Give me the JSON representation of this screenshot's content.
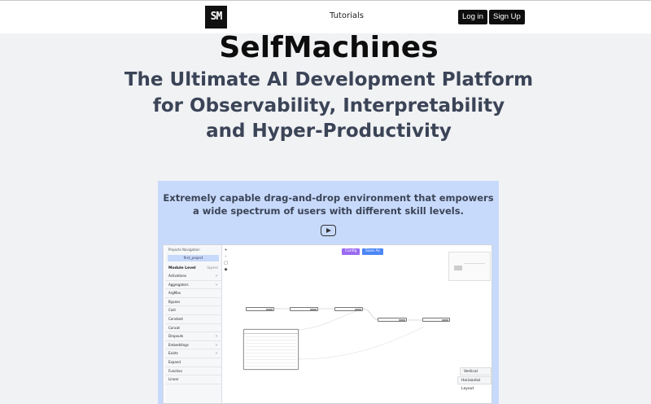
{
  "header": {
    "logo_text": "SM",
    "nav_tutorials": "Tutorials",
    "login_label": "Log in",
    "signup_label": "Sign Up"
  },
  "hero": {
    "title": "SelfMachines",
    "subtitle_line1": "The Ultimate AI Development Platform",
    "subtitle_line2": "for Observability, Interpretability",
    "subtitle_line3": "and Hyper-Productivity"
  },
  "feature": {
    "line1": "Extremely capable drag-and-drop environment that empowers",
    "line2": "a wide spectrum of users with different skill levels.",
    "play_icon": "play-icon"
  },
  "screenshot": {
    "nav_label": "Projects Navigation",
    "project_name": "first_project",
    "module_level": "Module Level",
    "layers": "layers",
    "items": [
      {
        "label": "Activations",
        "chevron": true
      },
      {
        "label": "Aggregators",
        "chevron": true
      },
      {
        "label": "ArgMax",
        "chevron": false
      },
      {
        "label": "Bypass",
        "chevron": false
      },
      {
        "label": "Cast",
        "chevron": false
      },
      {
        "label": "Constant",
        "chevron": false
      },
      {
        "label": "Concat",
        "chevron": false
      },
      {
        "label": "Dropouts",
        "chevron": true
      },
      {
        "label": "Embeddings",
        "chevron": true
      },
      {
        "label": "Exists",
        "chevron": true
      },
      {
        "label": "Expand",
        "chevron": false
      },
      {
        "label": "Function",
        "chevron": false
      },
      {
        "label": "Linear",
        "chevron": false
      }
    ],
    "config_label": "Config",
    "saveas_label": "Save As",
    "vertical_layout": "Vertical Layout",
    "horizontal_layout": "Horizontal Layout",
    "accent_config": "#9a6bf0",
    "accent_save": "#4d86f5"
  }
}
